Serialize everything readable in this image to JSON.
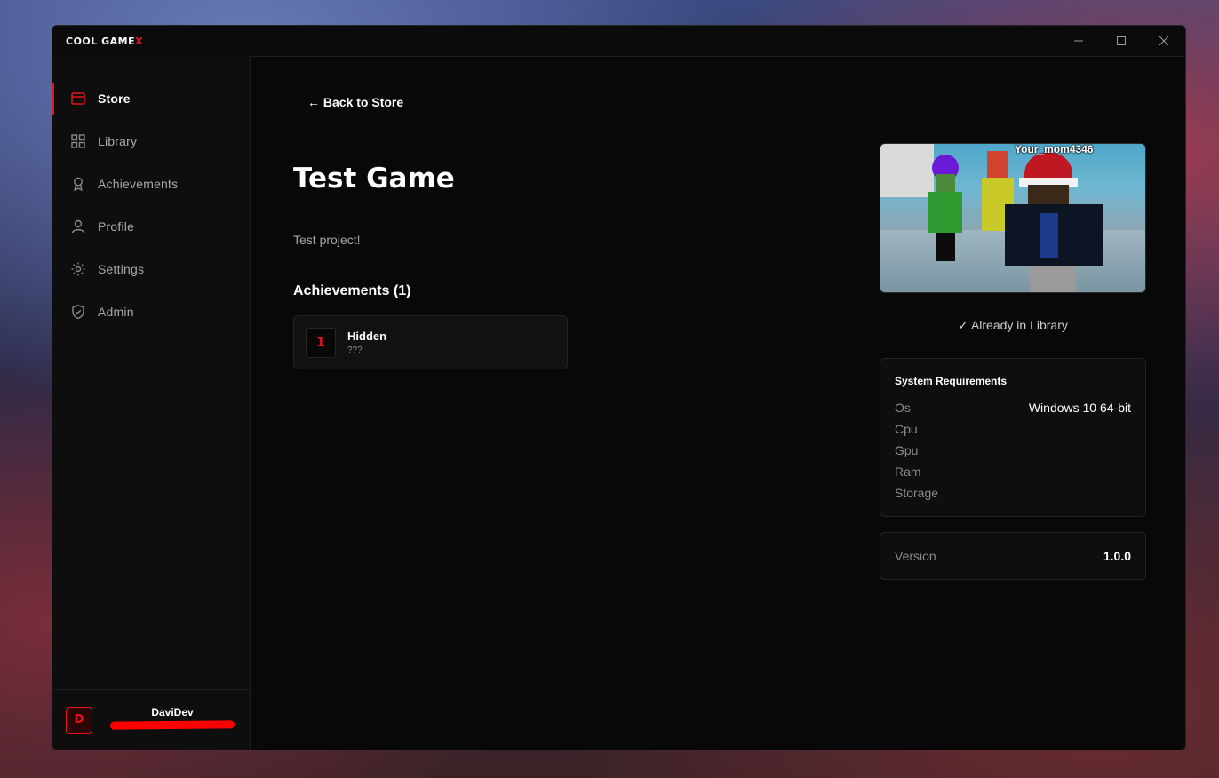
{
  "app": {
    "brand": "COOL GAME",
    "brand_accent": "X",
    "accent_color": "#e5141b"
  },
  "window_controls": {
    "minimize": "—",
    "maximize": "☐",
    "close": "✕"
  },
  "sidebar": {
    "items": [
      {
        "label": "Store",
        "icon": "store-icon",
        "active": true
      },
      {
        "label": "Library",
        "icon": "grid-icon",
        "active": false
      },
      {
        "label": "Achievements",
        "icon": "award-icon",
        "active": false
      },
      {
        "label": "Profile",
        "icon": "user-icon",
        "active": false
      },
      {
        "label": "Settings",
        "icon": "gear-icon",
        "active": false
      },
      {
        "label": "Admin",
        "icon": "shield-icon",
        "active": false
      }
    ],
    "user": {
      "initial": "D",
      "name": "DaviDev"
    }
  },
  "main": {
    "back_link": "← Back to Store",
    "title": "Test Game",
    "description": "Test project!",
    "achievements_heading": "Achievements (1)",
    "achievements": [
      {
        "number": "1",
        "name": "Hidden",
        "description": "???"
      }
    ],
    "screenshot_tag": "Your_mom4346",
    "library_status": "✓ Already in Library",
    "requirements": {
      "title": "System Requirements",
      "rows": [
        {
          "label": "Os",
          "value": "Windows 10 64-bit"
        },
        {
          "label": "Cpu",
          "value": ""
        },
        {
          "label": "Gpu",
          "value": ""
        },
        {
          "label": "Ram",
          "value": ""
        },
        {
          "label": "Storage",
          "value": ""
        }
      ]
    },
    "version": {
      "label": "Version",
      "value": "1.0.0"
    }
  }
}
